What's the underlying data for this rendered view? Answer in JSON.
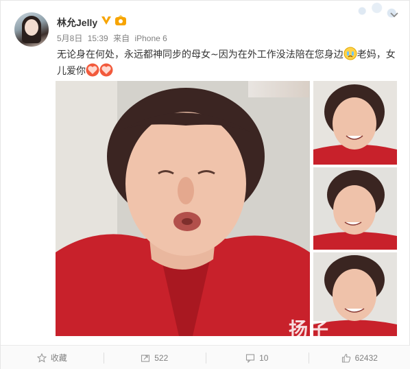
{
  "post": {
    "author": "林允Jelly",
    "date": "5月8日",
    "time": "15:39",
    "source_prefix": "来自",
    "source": "iPhone 6",
    "text_part1": "无论身在何处，永远都神同步的母女~因为在外工作没法陪在您身边",
    "text_part2": "老妈，女儿爱你",
    "emojis": [
      "crying-face-icon",
      "heart-icon",
      "heart-icon"
    ]
  },
  "watermark": "扬子",
  "actions": {
    "favorite_label": "收藏",
    "repost_count": "522",
    "comment_count": "10",
    "like_count": "62432"
  },
  "colors": {
    "accent_orange": "#f7a400",
    "jacket_red": "#c8212b",
    "text_gray": "#808080"
  }
}
